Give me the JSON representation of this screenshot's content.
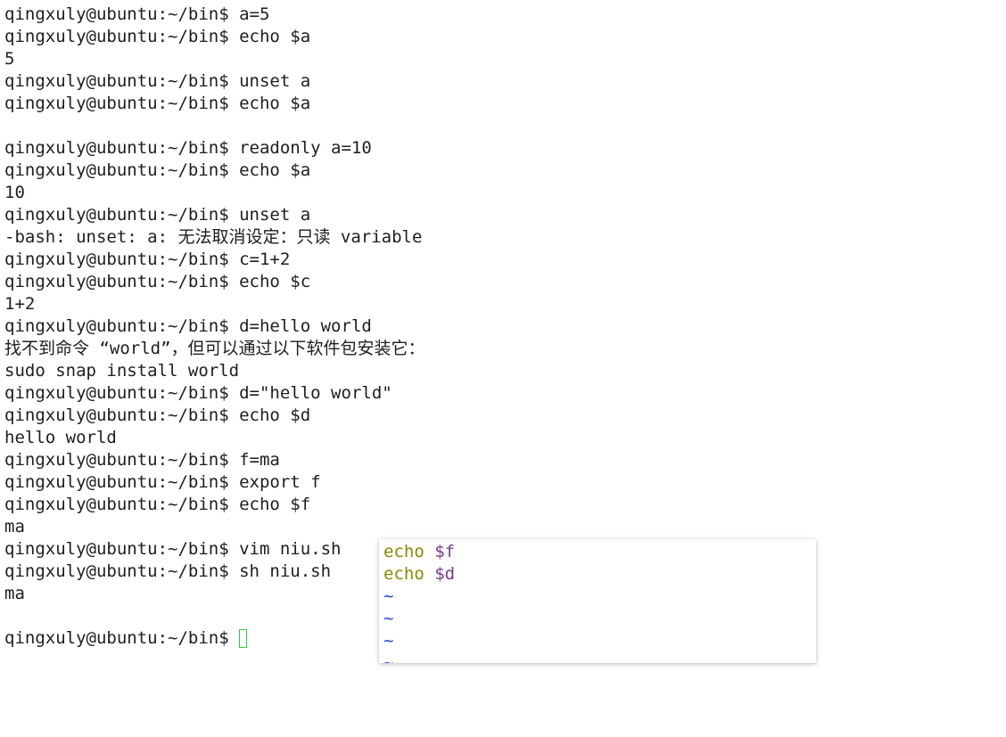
{
  "terminal": {
    "lines": [
      {
        "prompt": "qingxuly@ubuntu:~/bin$ ",
        "text": "a=5"
      },
      {
        "prompt": "qingxuly@ubuntu:~/bin$ ",
        "text": "echo $a"
      },
      {
        "prompt": "",
        "text": "5"
      },
      {
        "prompt": "qingxuly@ubuntu:~/bin$ ",
        "text": "unset a"
      },
      {
        "prompt": "qingxuly@ubuntu:~/bin$ ",
        "text": "echo $a"
      },
      {
        "prompt": "",
        "text": ""
      },
      {
        "prompt": "qingxuly@ubuntu:~/bin$ ",
        "text": "readonly a=10"
      },
      {
        "prompt": "qingxuly@ubuntu:~/bin$ ",
        "text": "echo $a"
      },
      {
        "prompt": "",
        "text": "10"
      },
      {
        "prompt": "qingxuly@ubuntu:~/bin$ ",
        "text": "unset a"
      },
      {
        "prompt": "",
        "text": "-bash: unset: a: 无法取消设定：只读 variable"
      },
      {
        "prompt": "qingxuly@ubuntu:~/bin$ ",
        "text": "c=1+2"
      },
      {
        "prompt": "qingxuly@ubuntu:~/bin$ ",
        "text": "echo $c"
      },
      {
        "prompt": "",
        "text": "1+2"
      },
      {
        "prompt": "qingxuly@ubuntu:~/bin$ ",
        "text": "d=hello world"
      },
      {
        "prompt": "",
        "text": "找不到命令 “world”，但可以通过以下软件包安装它："
      },
      {
        "prompt": "",
        "text": "sudo snap install world"
      },
      {
        "prompt": "qingxuly@ubuntu:~/bin$ ",
        "text": "d=\"hello world\""
      },
      {
        "prompt": "qingxuly@ubuntu:~/bin$ ",
        "text": "echo $d"
      },
      {
        "prompt": "",
        "text": "hello world"
      },
      {
        "prompt": "qingxuly@ubuntu:~/bin$ ",
        "text": "f=ma"
      },
      {
        "prompt": "qingxuly@ubuntu:~/bin$ ",
        "text": "export f"
      },
      {
        "prompt": "qingxuly@ubuntu:~/bin$ ",
        "text": "echo $f"
      },
      {
        "prompt": "",
        "text": "ma"
      },
      {
        "prompt": "qingxuly@ubuntu:~/bin$ ",
        "text": "vim niu.sh"
      },
      {
        "prompt": "qingxuly@ubuntu:~/bin$ ",
        "text": "sh niu.sh"
      },
      {
        "prompt": "",
        "text": "ma"
      },
      {
        "prompt": "",
        "text": ""
      }
    ],
    "current_prompt": "qingxuly@ubuntu:~/bin$ ",
    "cursor_color": "#2bd43a"
  },
  "vim": {
    "lines": [
      {
        "keyword": "echo",
        "variable": "$f"
      },
      {
        "keyword": "echo",
        "variable": "$d"
      }
    ],
    "tilde": "~",
    "keyword_color": "#8a8a00",
    "variable_color": "#7b3a8a",
    "tilde_color": "#2a3ee0"
  }
}
